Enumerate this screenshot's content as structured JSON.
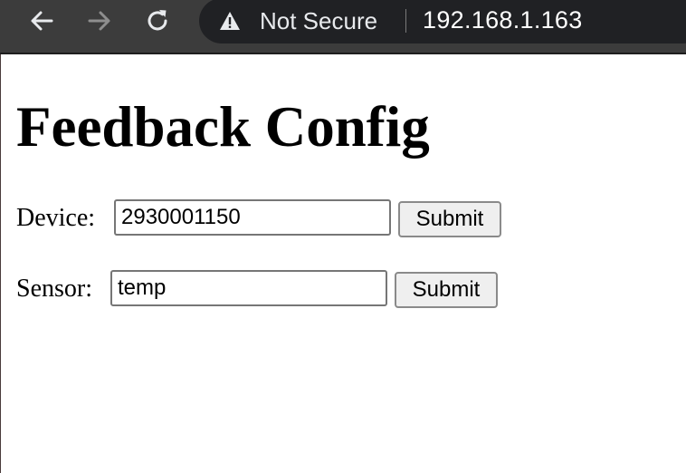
{
  "browser": {
    "security_label": "Not Secure",
    "url": "192.168.1.163",
    "icons": [
      "back-arrow-icon",
      "forward-arrow-icon",
      "reload-icon",
      "warning-icon"
    ]
  },
  "page": {
    "title": "Feedback Config",
    "device": {
      "label": "Device:",
      "value": "2930001150",
      "submit_label": "Submit"
    },
    "sensor": {
      "label": "Sensor:",
      "value": "temp",
      "submit_label": "Submit"
    }
  }
}
